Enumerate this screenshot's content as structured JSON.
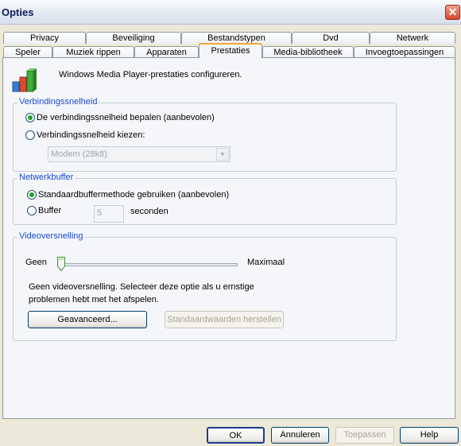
{
  "window": {
    "title": "Opties",
    "close_icon": "close-icon"
  },
  "tabs_row1": [
    "Privacy",
    "Beveiliging",
    "Bestandstypen",
    "Dvd",
    "Netwerk"
  ],
  "tabs_row2": [
    "Speler",
    "Muziek rippen",
    "Apparaten",
    "Prestaties",
    "Media-bibliotheek",
    "Invoegtoepassingen"
  ],
  "active_tab": "Prestaties",
  "header": {
    "icon": "performance-chart-icon",
    "text": "Windows Media Player-prestaties configureren."
  },
  "connection": {
    "legend": "Verbindingssnelheid",
    "option_auto": "De verbindingssnelheid bepalen (aanbevolen)",
    "option_choose": "Verbindingssnelheid kiezen:",
    "selected": "auto",
    "speed_value": "Modem (28k8)"
  },
  "buffer": {
    "legend": "Netwerkbuffer",
    "option_default": "Standaardbuffermethode gebruiken (aanbevolen)",
    "option_buffer": "Buffer",
    "seconds_value": "5",
    "seconds_label": "seconden",
    "selected": "default"
  },
  "video": {
    "legend": "Videoversnelling",
    "min_label": "Geen",
    "max_label": "Maximaal",
    "slider_level": 0,
    "description": "Geen videoversnelling. Selecteer deze optie als u ernstige problemen hebt met het afspelen.",
    "advanced_button": "Geavanceerd...",
    "restore_button": "Standaardwaarden herstellen"
  },
  "footer": {
    "ok": "OK",
    "cancel": "Annuleren",
    "apply": "Toepassen",
    "help": "Help"
  }
}
